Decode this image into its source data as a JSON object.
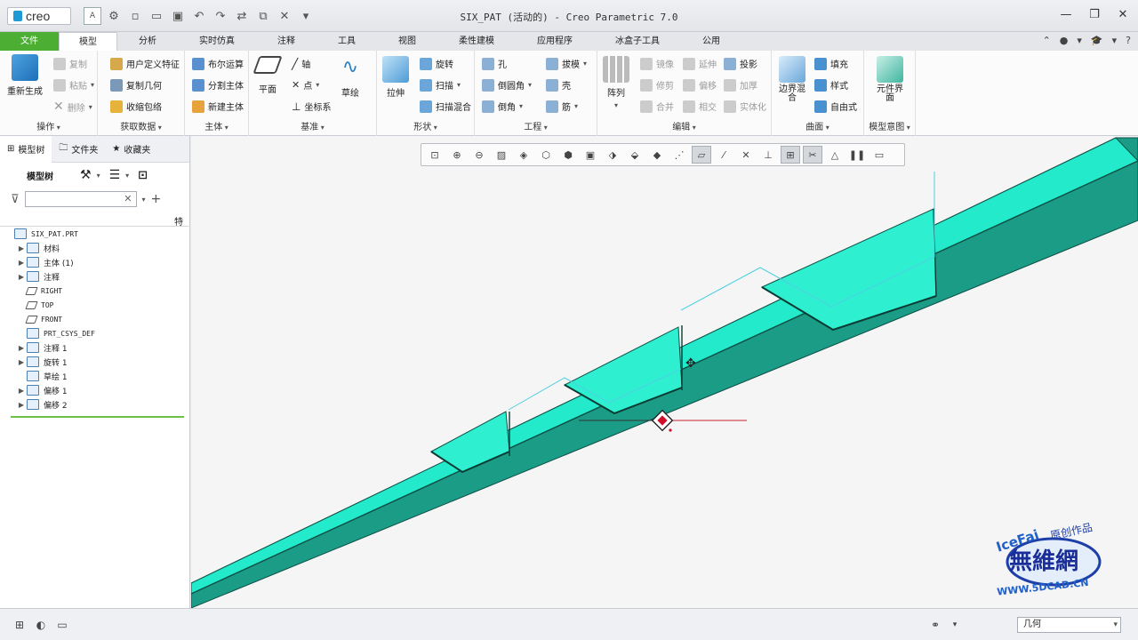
{
  "app": {
    "logo": "creo",
    "title": "SIX_PAT (活动的) - Creo Parametric 7.0"
  },
  "tabs": [
    "文件",
    "模型",
    "分析",
    "实时仿真",
    "注释",
    "工具",
    "视图",
    "柔性建模",
    "应用程序",
    "冰盒子工具",
    "公用"
  ],
  "ribbon": {
    "operations": {
      "label": "操作",
      "regen": "重新生成",
      "copy": "复制",
      "paste": "粘贴",
      "delete": "删除"
    },
    "get_data": {
      "label": "获取数据",
      "udf": "用户定义特征",
      "copy_geom": "复制几何",
      "shrinkwrap": "收缩包络"
    },
    "body": {
      "label": "主体",
      "boolean": "布尔运算",
      "split": "分割主体",
      "new": "新建主体"
    },
    "datum": {
      "label": "基准",
      "plane": "平面",
      "axis": "轴",
      "point": "点",
      "csys": "坐标系",
      "sketch": "草绘"
    },
    "shapes": {
      "label": "形状",
      "extrude": "拉伸",
      "revolve": "旋转",
      "sweep": "扫描",
      "swept_blend": "扫描混合"
    },
    "engineering": {
      "label": "工程",
      "hole": "孔",
      "round": "倒圆角",
      "chamfer": "倒角",
      "draft": "拔模",
      "shell": "壳",
      "rib": "筋"
    },
    "editing": {
      "label": "编辑",
      "pattern": "阵列",
      "mirror": "镜像",
      "trim": "修剪",
      "merge": "合并",
      "extend": "延伸",
      "offset": "偏移",
      "intersect": "相交",
      "project": "投影",
      "thicken": "加厚",
      "solidify": "实体化"
    },
    "surfaces": {
      "label": "曲面",
      "boundary": "边界混合",
      "fill": "填充",
      "style": "样式",
      "freestyle": "自由式"
    },
    "intent": {
      "label": "模型意图",
      "element": "元件界面"
    }
  },
  "left_panel": {
    "tabs": [
      "模型树",
      "文件夹",
      "收藏夹"
    ],
    "toolbar_label": "模型树",
    "filter_placeholder": "",
    "column_header": "特",
    "tree": [
      {
        "label": "SIX_PAT.PRT",
        "expand": "",
        "indent": 0
      },
      {
        "label": "材料",
        "expand": "▶",
        "indent": 1
      },
      {
        "label": "主体 (1)",
        "expand": "▶",
        "indent": 1
      },
      {
        "label": "注释",
        "expand": "▶",
        "indent": 1
      },
      {
        "label": "RIGHT",
        "expand": "",
        "indent": 1,
        "plane": true
      },
      {
        "label": "TOP",
        "expand": "",
        "indent": 1,
        "plane": true
      },
      {
        "label": "FRONT",
        "expand": "",
        "indent": 1,
        "plane": true
      },
      {
        "label": "PRT_CSYS_DEF",
        "expand": "",
        "indent": 1
      },
      {
        "label": "注释 1",
        "expand": "▶",
        "indent": 1
      },
      {
        "label": "旋转 1",
        "expand": "▶",
        "indent": 1
      },
      {
        "label": "草绘 1",
        "expand": "",
        "indent": 1
      },
      {
        "label": "偏移 1",
        "expand": "▶",
        "indent": 1
      },
      {
        "label": "偏移 2",
        "expand": "▶",
        "indent": 1
      }
    ]
  },
  "status_bar": {
    "filter": "几何"
  },
  "watermark": {
    "line1": "IceFai",
    "line2": "原创作品",
    "line3": "無維網",
    "url": "WWW.5DCAD.CN"
  },
  "colors": {
    "file_tab": "#4caf33",
    "model_face": "#24e6c6",
    "model_side": "#1a9c86",
    "accent": "#1f9ad6"
  }
}
